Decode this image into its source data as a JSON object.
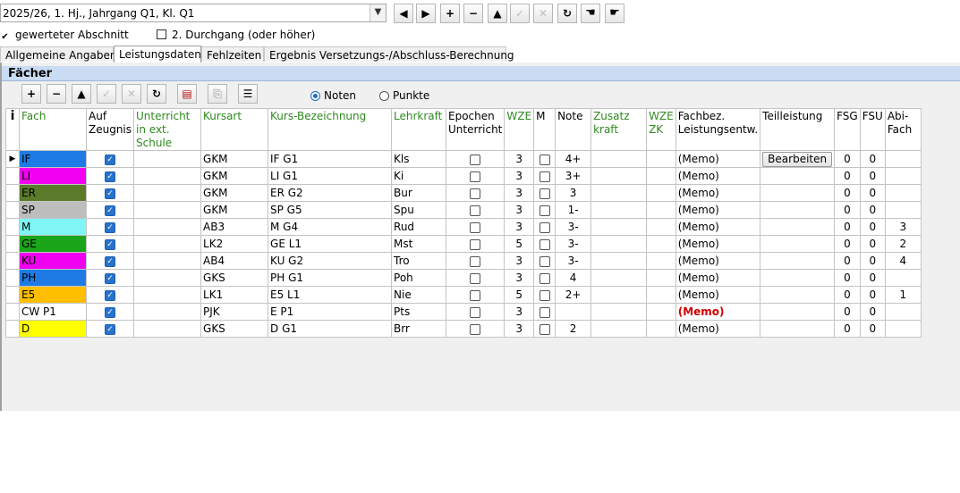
{
  "header": {
    "selector_value": "2025/26, 1. Hj., Jahrgang Q1, Kl. Q1",
    "nav_buttons": [
      "◄",
      "►",
      "+",
      "−",
      "▲",
      "↗",
      "✕",
      "↻",
      "☚",
      "☛"
    ]
  },
  "options": {
    "gewerteter_label": "gewerteter Abschnitt",
    "gewerteter_checked": true,
    "durchgang_label": "2. Durchgang (oder höher)",
    "durchgang_checked": false
  },
  "tabs": [
    "Allgemeine Angaben",
    "Leistungsdaten",
    "Fehlzeiten",
    "Ergebnis Versetzungs-/Abschluss-Berechnung"
  ],
  "active_tab": 1,
  "section": {
    "title": "Fächer",
    "radio_noten": "Noten",
    "radio_punkte": "Punkte",
    "selected": "Noten"
  },
  "table": {
    "headers": {
      "info": "i",
      "fach": "Fach",
      "auf_zeugnis": "Auf Zeugnis",
      "ext_schule": "Unterricht in ext. Schule",
      "kursart": "Kursart",
      "kursbez": "Kurs-Bezeichnung",
      "lehrkraft": "Lehrkraft",
      "epochen": "Epochen Unterricht",
      "wze": "WZE",
      "m": "M",
      "note": "Note",
      "zusatzkraft": "Zusatz kraft",
      "wzezk": "WZE ZK",
      "fachbez": "Fachbez. Leistungsentw.",
      "teilleistung": "Teilleistung",
      "fsg": "FSG",
      "fsu": "FSU",
      "abifach": "Abi-Fach"
    },
    "bearbeiten_label": "Bearbeiten",
    "rows": [
      {
        "fach": "IF",
        "color": "#1e7be6",
        "zeugnis": true,
        "kursart": "GKM",
        "kurs": "IF G1",
        "lehrkraft": "Kls",
        "epochen": false,
        "wze": "3",
        "m": false,
        "note": "4+",
        "memo": "(Memo)",
        "memo_red": false,
        "teil": true,
        "fsg": "0",
        "fsu": "0",
        "abi": "",
        "indicator": true
      },
      {
        "fach": "LI",
        "color": "#f000f0",
        "zeugnis": true,
        "kursart": "GKM",
        "kurs": "LI G1",
        "lehrkraft": "Ki",
        "epochen": false,
        "wze": "3",
        "m": false,
        "note": "3+",
        "memo": "(Memo)",
        "memo_red": false,
        "teil": false,
        "fsg": "0",
        "fsu": "0",
        "abi": "",
        "indicator": false
      },
      {
        "fach": "ER",
        "color": "#5b7a2a",
        "zeugnis": true,
        "kursart": "GKM",
        "kurs": "ER G2",
        "lehrkraft": "Bur",
        "epochen": false,
        "wze": "3",
        "m": false,
        "note": "3",
        "memo": "(Memo)",
        "memo_red": false,
        "teil": false,
        "fsg": "0",
        "fsu": "0",
        "abi": "",
        "indicator": false
      },
      {
        "fach": "SP",
        "color": "#bdbdbd",
        "zeugnis": true,
        "kursart": "GKM",
        "kurs": "SP G5",
        "lehrkraft": "Spu",
        "epochen": false,
        "wze": "3",
        "m": false,
        "note": "1-",
        "memo": "(Memo)",
        "memo_red": false,
        "teil": false,
        "fsg": "0",
        "fsu": "0",
        "abi": "",
        "indicator": false
      },
      {
        "fach": "M",
        "color": "#7ff5f5",
        "zeugnis": true,
        "kursart": "AB3",
        "kurs": "M  G4",
        "lehrkraft": "Rud",
        "epochen": false,
        "wze": "3",
        "m": false,
        "note": "3-",
        "memo": "(Memo)",
        "memo_red": false,
        "teil": false,
        "fsg": "0",
        "fsu": "0",
        "abi": "3",
        "indicator": false
      },
      {
        "fach": "GE",
        "color": "#1aa51a",
        "zeugnis": true,
        "kursart": "LK2",
        "kurs": "GE L1",
        "lehrkraft": "Mst",
        "epochen": false,
        "wze": "5",
        "m": false,
        "note": "3-",
        "memo": "(Memo)",
        "memo_red": false,
        "teil": false,
        "fsg": "0",
        "fsu": "0",
        "abi": "2",
        "indicator": false
      },
      {
        "fach": "KU",
        "color": "#f000f0",
        "zeugnis": true,
        "kursart": "AB4",
        "kurs": "KU G2",
        "lehrkraft": "Tro",
        "epochen": false,
        "wze": "3",
        "m": false,
        "note": "3-",
        "memo": "(Memo)",
        "memo_red": false,
        "teil": false,
        "fsg": "0",
        "fsu": "0",
        "abi": "4",
        "indicator": false
      },
      {
        "fach": "PH",
        "color": "#1e7be6",
        "zeugnis": true,
        "kursart": "GKS",
        "kurs": "PH G1",
        "lehrkraft": "Poh",
        "epochen": false,
        "wze": "3",
        "m": false,
        "note": "4",
        "memo": "(Memo)",
        "memo_red": false,
        "teil": false,
        "fsg": "0",
        "fsu": "0",
        "abi": "",
        "indicator": false
      },
      {
        "fach": "E5",
        "color": "#ffbf00",
        "zeugnis": true,
        "kursart": "LK1",
        "kurs": "E5 L1",
        "lehrkraft": "Nie",
        "epochen": false,
        "wze": "5",
        "m": false,
        "note": "2+",
        "memo": "(Memo)",
        "memo_red": false,
        "teil": false,
        "fsg": "0",
        "fsu": "0",
        "abi": "1",
        "indicator": false
      },
      {
        "fach": "CW P1",
        "color": "#ffffff",
        "zeugnis": true,
        "kursart": "PJK",
        "kurs": "E  P1",
        "lehrkraft": "Pts",
        "epochen": false,
        "wze": "3",
        "m": false,
        "note": "",
        "memo": "(Memo)",
        "memo_red": true,
        "teil": false,
        "fsg": "0",
        "fsu": "0",
        "abi": "",
        "indicator": false
      },
      {
        "fach": "D",
        "color": "#ffff00",
        "zeugnis": true,
        "kursart": "GKS",
        "kurs": "D  G1",
        "lehrkraft": "Brr",
        "epochen": false,
        "wze": "3",
        "m": false,
        "note": "2",
        "memo": "(Memo)",
        "memo_red": false,
        "teil": false,
        "fsg": "0",
        "fsu": "0",
        "abi": "",
        "indicator": false
      }
    ]
  }
}
